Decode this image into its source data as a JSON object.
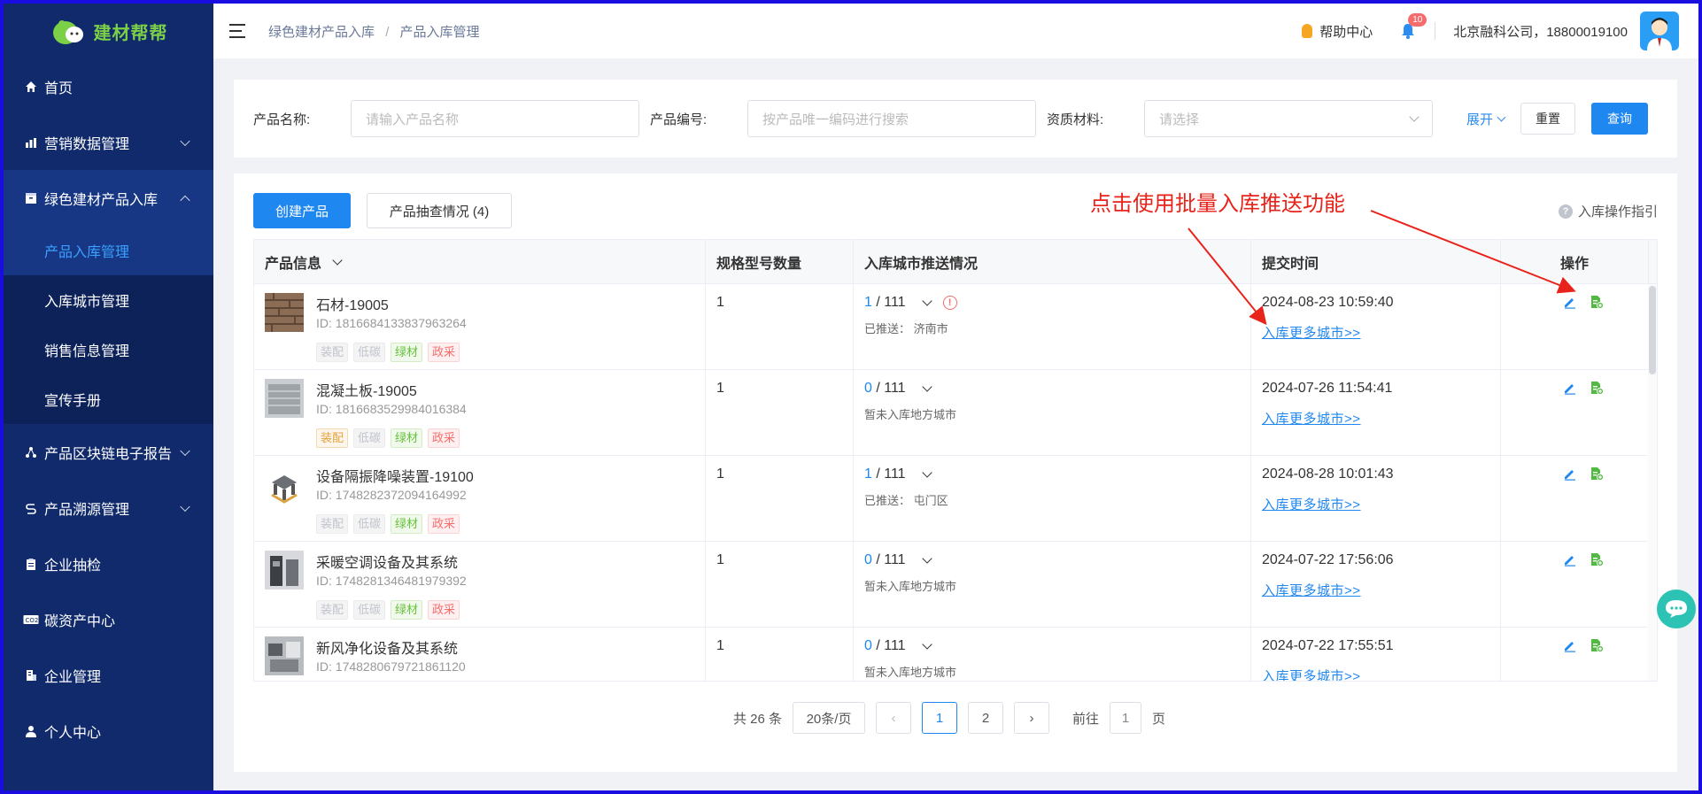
{
  "app": {
    "logo_text": "建材帮帮"
  },
  "sidebar": {
    "items": [
      {
        "label": "首页",
        "icon": "home-icon"
      },
      {
        "label": "营销数据管理",
        "icon": "chart-icon"
      },
      {
        "label": "绿色建材产品入库",
        "icon": "box-icon"
      },
      {
        "label": "产品区块链电子报告",
        "icon": "blockchain-icon"
      },
      {
        "label": "产品溯源管理",
        "icon": "trace-icon"
      },
      {
        "label": "企业抽检",
        "icon": "clipboard-icon"
      },
      {
        "label": "碳资产中心",
        "icon": "co2-icon"
      },
      {
        "label": "企业管理",
        "icon": "building-icon"
      },
      {
        "label": "个人中心",
        "icon": "user-icon"
      }
    ],
    "sub_items": [
      "产品入库管理",
      "入库城市管理",
      "销售信息管理",
      "宣传手册"
    ]
  },
  "header": {
    "breadcrumb": [
      "绿色建材产品入库",
      "产品入库管理"
    ],
    "breadcrumb_sep": "/",
    "help": "帮助中心",
    "notify_count": "10",
    "user": "北京融科公司，18800019100"
  },
  "search": {
    "product_name_label": "产品名称:",
    "product_name_placeholder": "请输入产品名称",
    "product_code_label": "产品编号:",
    "product_code_placeholder": "按产品唯一编码进行搜索",
    "material_label": "资质材料:",
    "material_placeholder": "请选择",
    "expand": "展开",
    "reset": "重置",
    "query": "查询"
  },
  "toolbar": {
    "create": "创建产品",
    "spot_check": "产品抽查情况 (4)",
    "guide": "入库操作指引",
    "annotation": "点击使用批量入库推送功能"
  },
  "table": {
    "headers": [
      "产品信息",
      "规格型号数量",
      "入库城市推送情况",
      "提交时间",
      "操作"
    ],
    "more_link": "入库更多城市>>",
    "tag_labels": [
      "装配",
      "低碳",
      "绿材",
      "政采"
    ],
    "rows": [
      {
        "name": "石材-19005",
        "id": "ID: 1816684133837963264",
        "qty": "1",
        "pushed_num": "1",
        "total": " / 111",
        "pushed_text": "已推送：  济南市",
        "time": "2024-08-23 10:59:40",
        "warn": true,
        "tag_states": [
          "grey",
          "grey",
          "green",
          "red"
        ]
      },
      {
        "name": "混凝土板-19005",
        "id": "ID: 1816683529984016384",
        "qty": "1",
        "pushed_num": "0",
        "total": " / 111",
        "pushed_text": "暂未入库地方城市",
        "time": "2024-07-26 11:54:41",
        "warn": false,
        "tag_states": [
          "orange",
          "grey",
          "green",
          "red"
        ]
      },
      {
        "name": "设备隔振降噪装置-19100",
        "id": "ID: 1748282372094164992",
        "qty": "1",
        "pushed_num": "1",
        "total": " / 111",
        "pushed_text": "已推送：  屯门区",
        "time": "2024-08-28 10:01:43",
        "warn": false,
        "tag_states": [
          "grey",
          "grey",
          "green",
          "red"
        ]
      },
      {
        "name": "采暖空调设备及其系统",
        "id": "ID: 1748281346481979392",
        "qty": "1",
        "pushed_num": "0",
        "total": " / 111",
        "pushed_text": "暂未入库地方城市",
        "time": "2024-07-22 17:56:06",
        "warn": false,
        "tag_states": [
          "grey",
          "grey",
          "green",
          "red"
        ]
      },
      {
        "name": "新风净化设备及其系统",
        "id": "ID: 1748280679721861120",
        "qty": "1",
        "pushed_num": "0",
        "total": " / 111",
        "pushed_text": "暂未入库地方城市",
        "time": "2024-07-22 17:55:51",
        "warn": false,
        "tag_states": [
          "grey",
          "grey",
          "green",
          "red"
        ]
      }
    ]
  },
  "pagination": {
    "total": "共 26 条",
    "page_size": "20条/页",
    "pages": [
      "1",
      "2"
    ],
    "goto_label": "前往",
    "goto_value": "1",
    "page_unit": "页"
  },
  "colors": {
    "sidebar_bg": "#102a6b",
    "primary": "#1f87f0",
    "annotation": "#e8231a"
  }
}
